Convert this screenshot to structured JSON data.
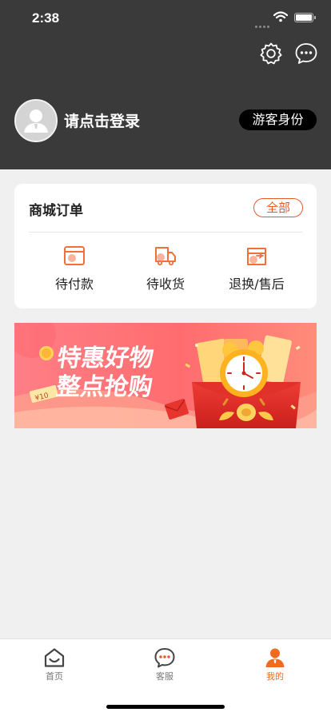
{
  "status_bar": {
    "time": "2:38"
  },
  "header": {
    "login_prompt": "请点击登录",
    "guest_badge": "游客身份",
    "icons": [
      "settings-icon",
      "chat-icon"
    ]
  },
  "orders": {
    "title": "商城订单",
    "all_label": "全部",
    "items": [
      {
        "label": "待付款",
        "icon": "wallet-icon"
      },
      {
        "label": "待收货",
        "icon": "truck-icon"
      },
      {
        "label": "退换/售后",
        "icon": "return-box-icon"
      }
    ]
  },
  "banner": {
    "line1": "特惠好物",
    "line2": "整点抢购",
    "coupon": "¥10"
  },
  "tabbar": {
    "items": [
      {
        "label": "首页",
        "icon": "home-icon"
      },
      {
        "label": "客服",
        "icon": "customer-service-icon"
      },
      {
        "label": "我的",
        "icon": "profile-icon",
        "active": true
      }
    ]
  },
  "colors": {
    "header_bg": "#3a3a3a",
    "accent": "#e4592c",
    "tab_active": "#f16a1f",
    "page_bg": "#f0f0f0"
  }
}
